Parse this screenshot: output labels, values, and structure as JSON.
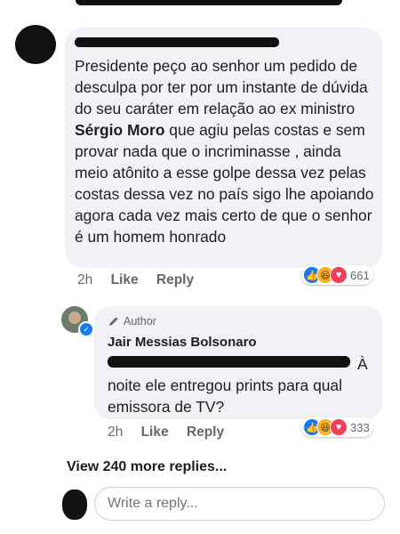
{
  "top_comment": {
    "text_before": "Presidente peço ao senhor um pedido de desculpa por ter por um instante de dúvida do seu caráter em relação ao ex ministro ",
    "text_bold": "Sérgio Moro",
    "text_after": " que agiu pelas costas e sem provar nada que o incriminasse  , ainda meio atônito a esse golpe dessa vez pelas costas dessa vez no país sigo lhe apoiando agora cada vez mais certo de que o senhor é um homem honrado",
    "time": "2h",
    "like_label": "Like",
    "reply_label": "Reply",
    "reactions": {
      "icons": [
        "like-icon",
        "haha-icon",
        "love-icon"
      ],
      "count": "661"
    }
  },
  "reply": {
    "author_badge": "Author",
    "author_name": "Jair Messias Bolsonaro",
    "text": "À noite ele entregou prints para qual emissora de TV?",
    "time": "2h",
    "like_label": "Like",
    "reply_label": "Reply",
    "reactions": {
      "icons": [
        "like-icon",
        "haha-icon",
        "love-icon"
      ],
      "count": "333"
    }
  },
  "view_more_label": "View 240 more replies...",
  "reply_box": {
    "placeholder": "Write a reply..."
  },
  "colors": {
    "accent": "#1877f2",
    "bubble": "#f0f2f5",
    "muted": "#65676b",
    "love": "#f33e58",
    "haha": "#f7b125"
  }
}
